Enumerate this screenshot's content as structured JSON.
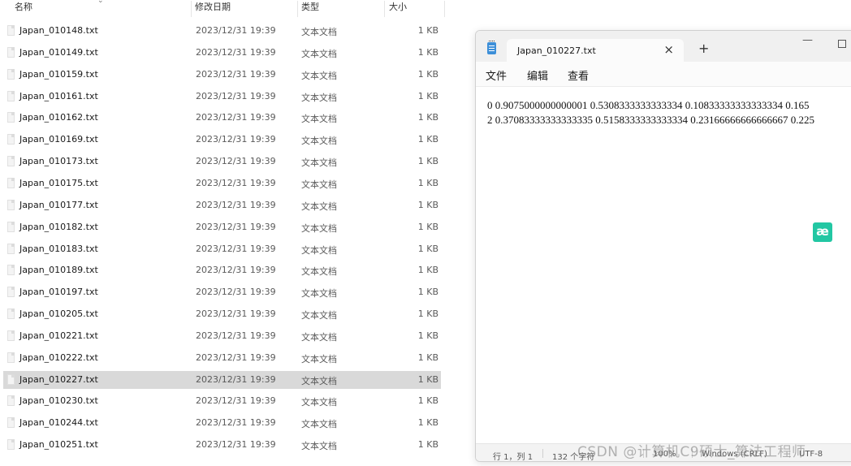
{
  "explorer": {
    "headers": {
      "name": "名称",
      "date": "修改日期",
      "type": "类型",
      "size": "大小"
    },
    "rows": [
      {
        "name": "Japan_010148.txt",
        "date": "2023/12/31 19:39",
        "type": "文本文档",
        "size": "1 KB"
      },
      {
        "name": "Japan_010149.txt",
        "date": "2023/12/31 19:39",
        "type": "文本文档",
        "size": "1 KB"
      },
      {
        "name": "Japan_010159.txt",
        "date": "2023/12/31 19:39",
        "type": "文本文档",
        "size": "1 KB"
      },
      {
        "name": "Japan_010161.txt",
        "date": "2023/12/31 19:39",
        "type": "文本文档",
        "size": "1 KB"
      },
      {
        "name": "Japan_010162.txt",
        "date": "2023/12/31 19:39",
        "type": "文本文档",
        "size": "1 KB"
      },
      {
        "name": "Japan_010169.txt",
        "date": "2023/12/31 19:39",
        "type": "文本文档",
        "size": "1 KB"
      },
      {
        "name": "Japan_010173.txt",
        "date": "2023/12/31 19:39",
        "type": "文本文档",
        "size": "1 KB"
      },
      {
        "name": "Japan_010175.txt",
        "date": "2023/12/31 19:39",
        "type": "文本文档",
        "size": "1 KB"
      },
      {
        "name": "Japan_010177.txt",
        "date": "2023/12/31 19:39",
        "type": "文本文档",
        "size": "1 KB"
      },
      {
        "name": "Japan_010182.txt",
        "date": "2023/12/31 19:39",
        "type": "文本文档",
        "size": "1 KB"
      },
      {
        "name": "Japan_010183.txt",
        "date": "2023/12/31 19:39",
        "type": "文本文档",
        "size": "1 KB"
      },
      {
        "name": "Japan_010189.txt",
        "date": "2023/12/31 19:39",
        "type": "文本文档",
        "size": "1 KB"
      },
      {
        "name": "Japan_010197.txt",
        "date": "2023/12/31 19:39",
        "type": "文本文档",
        "size": "1 KB"
      },
      {
        "name": "Japan_010205.txt",
        "date": "2023/12/31 19:39",
        "type": "文本文档",
        "size": "1 KB"
      },
      {
        "name": "Japan_010221.txt",
        "date": "2023/12/31 19:39",
        "type": "文本文档",
        "size": "1 KB"
      },
      {
        "name": "Japan_010222.txt",
        "date": "2023/12/31 19:39",
        "type": "文本文档",
        "size": "1 KB"
      },
      {
        "name": "Japan_010227.txt",
        "date": "2023/12/31 19:39",
        "type": "文本文档",
        "size": "1 KB",
        "selected": true
      },
      {
        "name": "Japan_010230.txt",
        "date": "2023/12/31 19:39",
        "type": "文本文档",
        "size": "1 KB"
      },
      {
        "name": "Japan_010244.txt",
        "date": "2023/12/31 19:39",
        "type": "文本文档",
        "size": "1 KB"
      },
      {
        "name": "Japan_010251.txt",
        "date": "2023/12/31 19:39",
        "type": "文本文档",
        "size": "1 KB"
      }
    ]
  },
  "notepad": {
    "tab_title": "Japan_010227.txt",
    "menu": {
      "file": "文件",
      "edit": "编辑",
      "view": "查看"
    },
    "content_lines": [
      "0 0.9075000000000001 0.5308333333333334 0.10833333333333334 0.165",
      "2 0.37083333333333335 0.5158333333333334 0.23166666666666667 0.225"
    ],
    "status": {
      "position": "行 1，列 1",
      "char_count": "132 个字符",
      "zoom": "100%",
      "line_ending": "Windows (CRLF)",
      "encoding": "UTF-8"
    }
  },
  "ae_badge": "æ",
  "watermark": "CSDN @计算机C9硕士_算法工程师",
  "colors": {
    "selected_row": "#d9d9d9",
    "ae_badge": "#22c7a3",
    "notepad_icon": "#3d8fd8"
  }
}
